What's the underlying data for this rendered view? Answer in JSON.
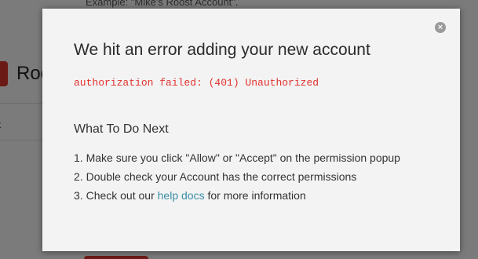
{
  "background": {
    "hint_text": "Example: \"Mike's Roost Account\".",
    "logo_text": "Roo",
    "marker": "t"
  },
  "modal": {
    "close_glyph": "×",
    "title": "We hit an error adding your new account",
    "error_message": "authorization failed: (401) Unauthorized",
    "next_heading": "What To Do Next",
    "steps": [
      {
        "num": "1. ",
        "text": "Make sure you click \"Allow\" or \"Accept\" on the permission popup"
      },
      {
        "num": "2. ",
        "text": "Double check your Account has the correct permissions"
      },
      {
        "num": "3. ",
        "pre": "Check out our ",
        "link": "help docs",
        "post": " for more information"
      }
    ]
  },
  "colors": {
    "error": "#e2312c",
    "link": "#3b8ea8",
    "brand": "#d9342b",
    "overlay": "rgba(0,0,0,0.5)"
  },
  "icons": {
    "close": "close-icon",
    "logo": "roost-logo-icon"
  }
}
